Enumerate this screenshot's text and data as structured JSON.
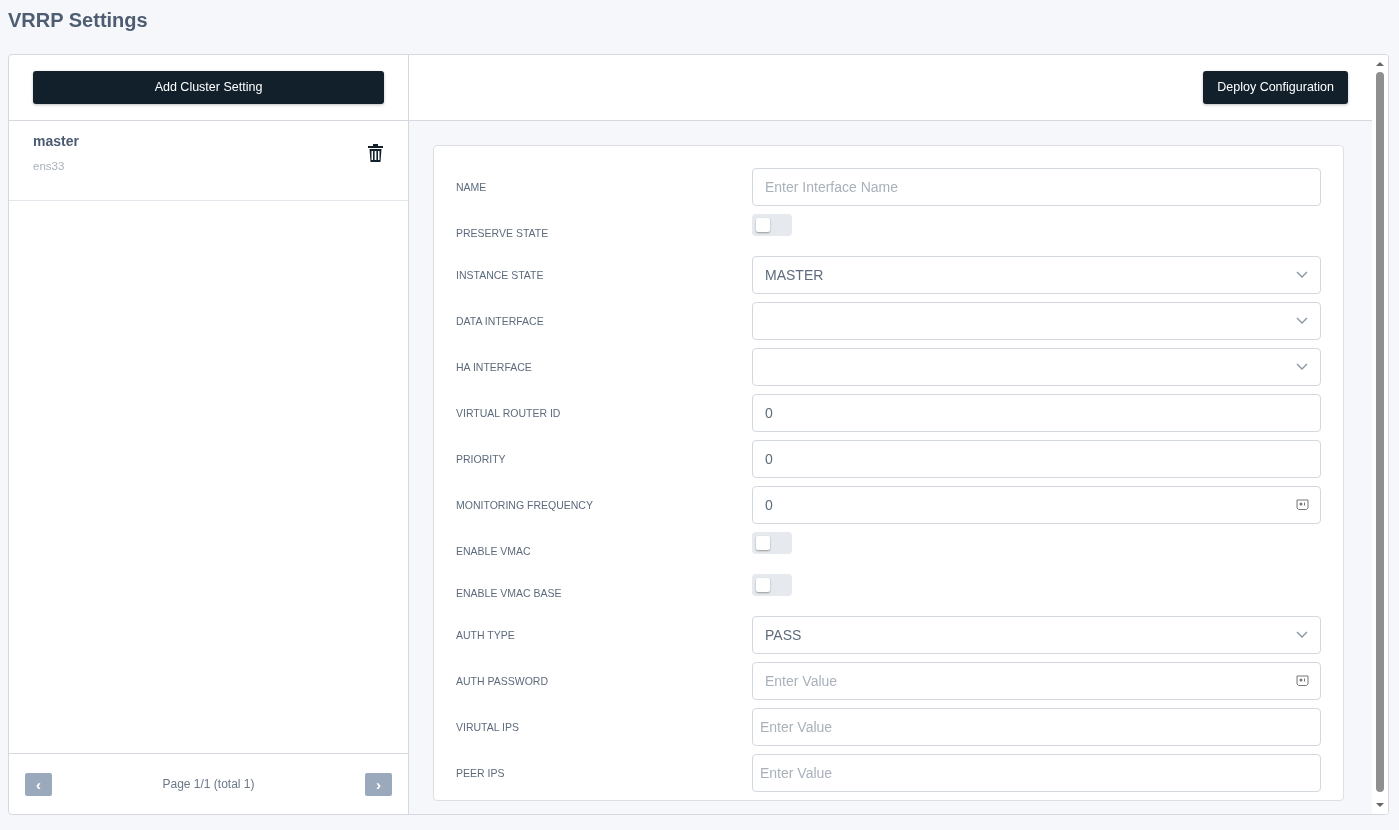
{
  "page_title": "VRRP Settings",
  "sidebar": {
    "add_button": "Add Cluster Setting",
    "items": [
      {
        "name": "master",
        "interface": "ens33",
        "selected": false
      }
    ],
    "pagination": {
      "prev": "‹",
      "label": "Page 1/1 (total 1)",
      "next": "›"
    }
  },
  "toolbar": {
    "deploy_button": "Deploy Configuration"
  },
  "form": {
    "fields": [
      {
        "kind": "text",
        "label": "NAME",
        "placeholder": "Enter Interface Name"
      },
      {
        "kind": "toggle",
        "label": "PRESERVE STATE",
        "on": false
      },
      {
        "kind": "select",
        "label": "INSTANCE STATE",
        "value": "MASTER"
      },
      {
        "kind": "select",
        "label": "DATA INTERFACE"
      },
      {
        "kind": "select",
        "label": "HA INTERFACE"
      },
      {
        "kind": "text",
        "label": "VIRTUAL ROUTER ID",
        "value": "0"
      },
      {
        "kind": "text",
        "label": "PRIORITY",
        "value": "0"
      },
      {
        "kind": "secret",
        "label": "MONITORING FREQUENCY",
        "value": "0"
      },
      {
        "kind": "toggle",
        "label": "ENABLE VMAC",
        "on": false
      },
      {
        "kind": "toggle",
        "label": "ENABLE VMAC BASE",
        "on": false
      },
      {
        "kind": "select",
        "label": "AUTH TYPE",
        "value": "PASS"
      },
      {
        "kind": "secret",
        "label": "AUTH PASSWORD",
        "placeholder": "Enter Value"
      },
      {
        "kind": "plain",
        "label": "VIRUTAL IPS",
        "placeholder": "Enter Value"
      },
      {
        "kind": "plain",
        "label": "PEER IPS",
        "placeholder": "Enter Value"
      }
    ]
  }
}
